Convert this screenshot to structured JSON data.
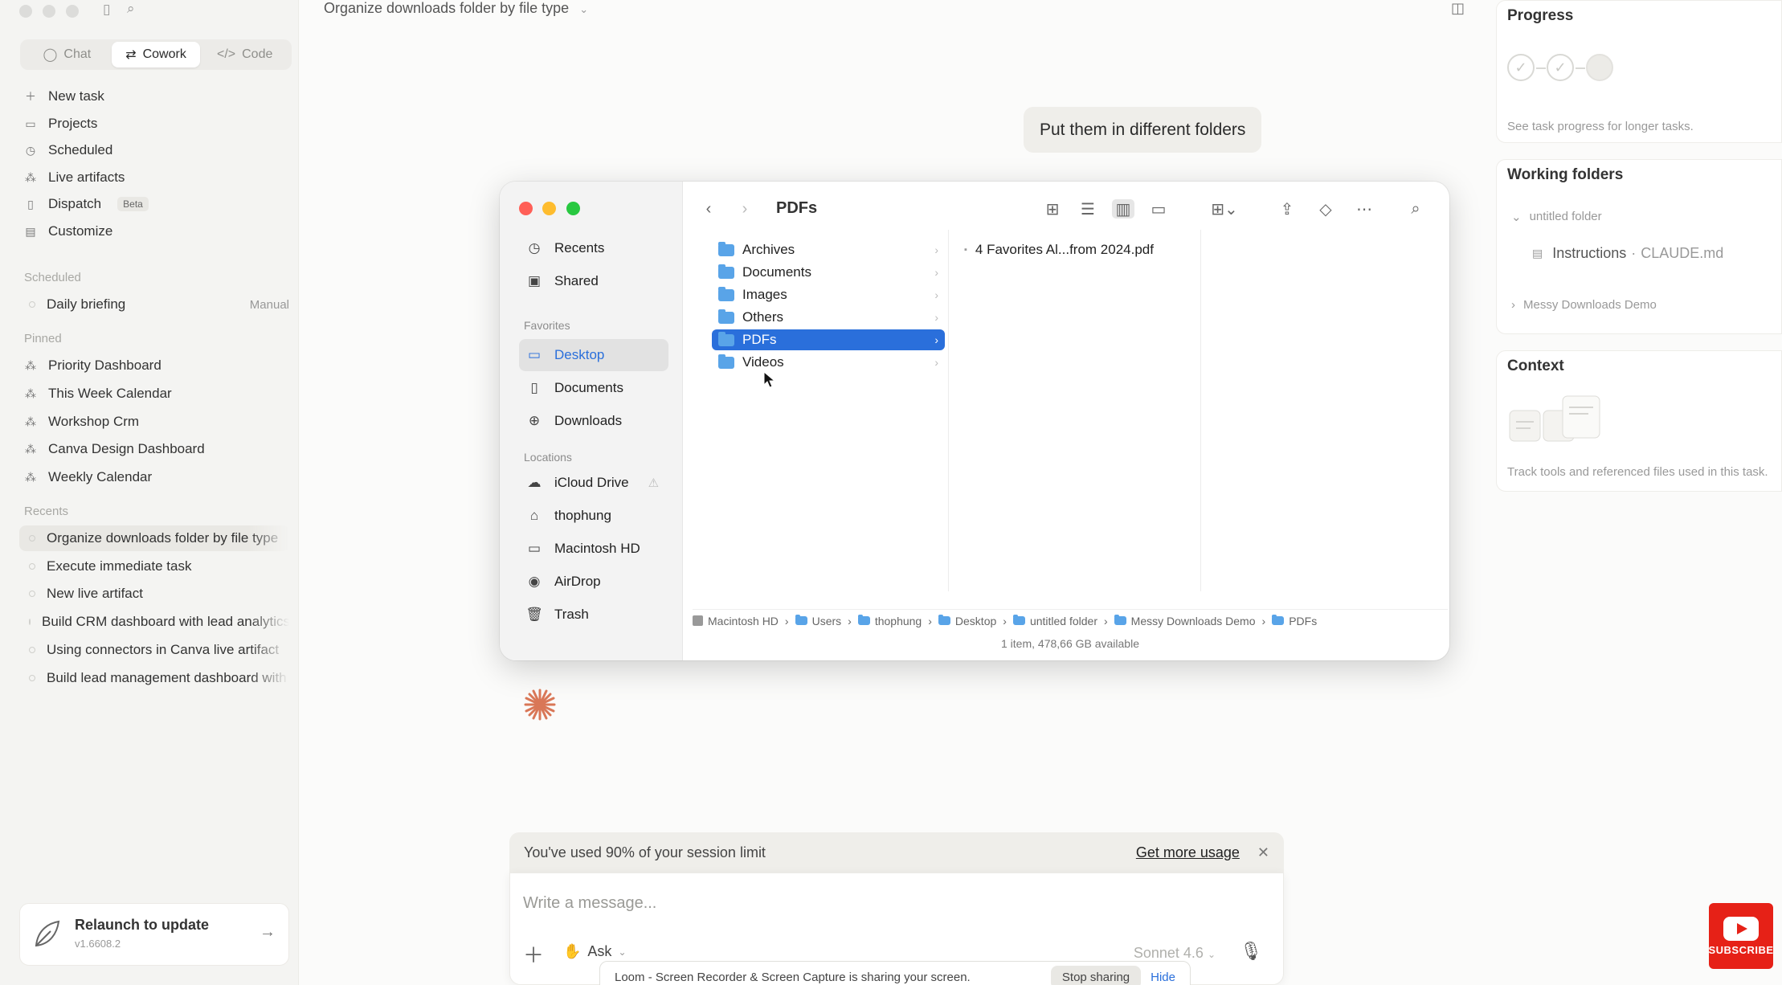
{
  "sidebar": {
    "modes": [
      {
        "label": "Chat",
        "icon": "chat-bubble-icon"
      },
      {
        "label": "Cowork",
        "icon": "cowork-icon"
      },
      {
        "label": "Code",
        "icon": "code-icon"
      }
    ],
    "nav": [
      {
        "label": "New task",
        "icon": "plus-icon"
      },
      {
        "label": "Projects",
        "icon": "folder-icon"
      },
      {
        "label": "Scheduled",
        "icon": "clock-icon"
      },
      {
        "label": "Live artifacts",
        "icon": "artifact-icon"
      },
      {
        "label": "Dispatch",
        "icon": "phone-icon",
        "badge": "Beta"
      },
      {
        "label": "Customize",
        "icon": "briefcase-icon"
      }
    ],
    "scheduled_label": "Scheduled",
    "scheduled": [
      {
        "label": "Daily briefing",
        "meta": "Manual"
      }
    ],
    "pinned_label": "Pinned",
    "pinned": [
      {
        "label": "Priority Dashboard"
      },
      {
        "label": "This Week Calendar"
      },
      {
        "label": "Workshop Crm"
      },
      {
        "label": "Canva Design Dashboard"
      },
      {
        "label": "Weekly Calendar"
      }
    ],
    "recents_label": "Recents",
    "recents": [
      {
        "label": "Organize downloads folder by file type"
      },
      {
        "label": "Execute immediate task"
      },
      {
        "label": "New live artifact"
      },
      {
        "label": "Build CRM dashboard with lead analytics"
      },
      {
        "label": "Using connectors in Canva live artifact"
      },
      {
        "label": "Build lead management dashboard with"
      }
    ],
    "update": {
      "title": "Relaunch to update",
      "version": "v1.6608.2"
    }
  },
  "main": {
    "title": "Organize downloads folder by file type",
    "user_message": "Put them in different folders"
  },
  "finder": {
    "title": "PDFs",
    "sidebar": {
      "top": [
        {
          "label": "Recents",
          "icon": "clock-icon"
        },
        {
          "label": "Shared",
          "icon": "shared-folder-icon"
        }
      ],
      "favorites_label": "Favorites",
      "favorites": [
        {
          "label": "Desktop",
          "icon": "desktop-icon"
        },
        {
          "label": "Documents",
          "icon": "document-icon"
        },
        {
          "label": "Downloads",
          "icon": "download-icon"
        }
      ],
      "locations_label": "Locations",
      "locations": [
        {
          "label": "iCloud Drive",
          "icon": "cloud-icon"
        },
        {
          "label": "thophung",
          "icon": "home-icon"
        },
        {
          "label": "Macintosh HD",
          "icon": "drive-icon"
        },
        {
          "label": "AirDrop",
          "icon": "airdrop-icon"
        },
        {
          "label": "Trash",
          "icon": "trash-icon"
        }
      ]
    },
    "column1": [
      {
        "label": "Archives"
      },
      {
        "label": "Documents"
      },
      {
        "label": "Images"
      },
      {
        "label": "Others"
      },
      {
        "label": "PDFs",
        "selected": true
      },
      {
        "label": "Videos"
      }
    ],
    "column2": [
      {
        "label": "4 Favorites Al...from 2024.pdf"
      }
    ],
    "path": [
      "Macintosh HD",
      "Users",
      "thophung",
      "Desktop",
      "untitled folder",
      "Messy Downloads Demo",
      "PDFs"
    ],
    "status": "1 item, 478,66 GB available"
  },
  "banner": {
    "text": "You've used 90% of your session limit",
    "link": "Get more usage"
  },
  "composer": {
    "placeholder": "Write a message...",
    "mode": "Ask",
    "model": "Sonnet 4.6"
  },
  "right_panel": {
    "progress": {
      "title": "Progress",
      "hint": "See task progress for longer tasks."
    },
    "working_folders": {
      "title": "Working folders",
      "folder": "untitled folder",
      "file_label": "Instructions",
      "file_name": "CLAUDE.md",
      "subfolder": "Messy Downloads Demo"
    },
    "context": {
      "title": "Context",
      "hint": "Track tools and referenced files used in this task."
    }
  },
  "share_bar": {
    "text": "Loom - Screen Recorder & Screen Capture is sharing your screen.",
    "stop": "Stop sharing",
    "hide": "Hide"
  },
  "youtube": {
    "label": "SUBSCRIBE"
  },
  "colors": {
    "accent": "#2a6fdb",
    "claude_orange": "#d97757",
    "folder_blue": "#59a4e8"
  }
}
